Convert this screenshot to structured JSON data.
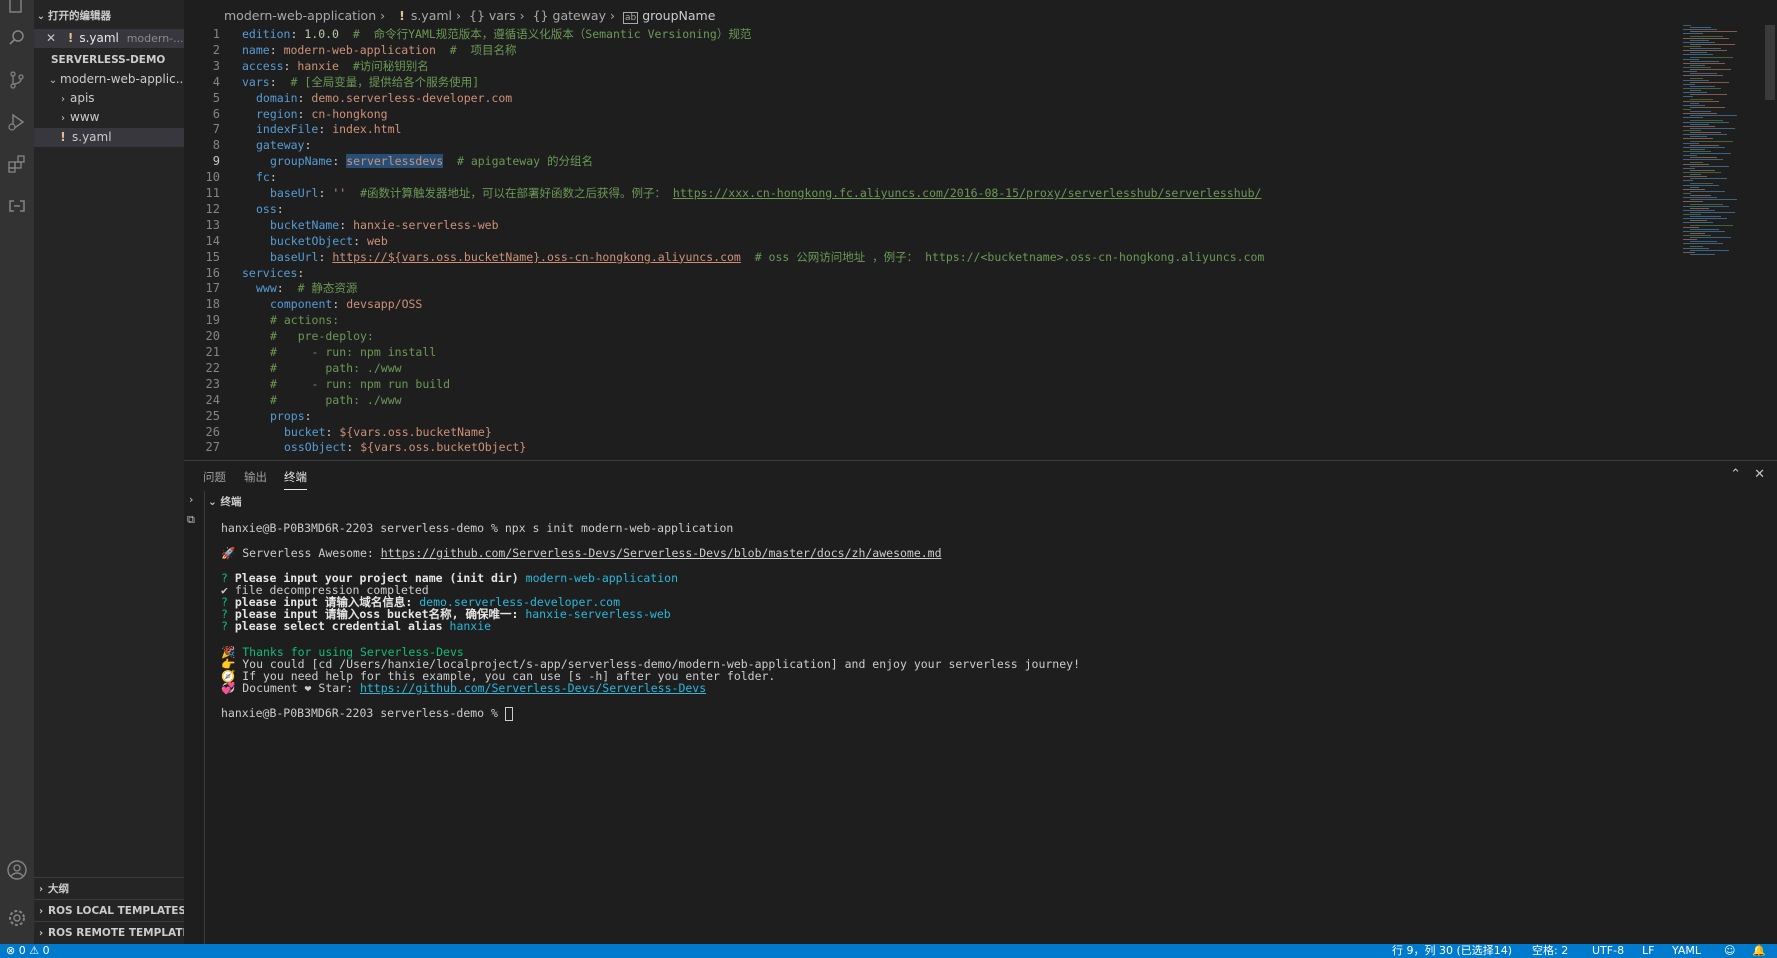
{
  "sidebar": {
    "open_editors_header": "打开的编辑器",
    "open_editor_file": "s.yaml",
    "open_editor_path": "modern-...",
    "workspace_header": "SERVERLESS-DEMO",
    "folder_root": "modern-web-applic...",
    "folder_apis": "apis",
    "folder_www": "www",
    "file_syaml": "s.yaml",
    "outline_header": "大纲",
    "ros_local": "ROS LOCAL TEMPLATES",
    "ros_remote": "ROS REMOTE TEMPLATES"
  },
  "breadcrumb": [
    "modern-web-application",
    "s.yaml",
    "vars",
    "gateway",
    "groupName"
  ],
  "editor": {
    "line_numbers": [
      "1",
      "2",
      "3",
      "4",
      "5",
      "6",
      "7",
      "8",
      "9",
      "10",
      "11",
      "12",
      "13",
      "14",
      "15",
      "16",
      "17",
      "18",
      "19",
      "20",
      "21",
      "22",
      "23",
      "24",
      "25",
      "26",
      "27"
    ],
    "lines": {
      "l1": {
        "k": "edition",
        "v": "1.0.0",
        "c": "#  命令行YAML规范版本，遵循语义化版本（Semantic Versioning）规范"
      },
      "l2": {
        "k": "name",
        "v": "modern-web-application",
        "c": "#  项目名称"
      },
      "l3": {
        "k": "access",
        "v": "hanxie",
        "c": "#访问秘钥别名"
      },
      "l4": {
        "k": "vars",
        "c": "# [全局变量，提供给各个服务使用]"
      },
      "l5": {
        "k": "domain",
        "v": "demo.serverless-developer.com"
      },
      "l6": {
        "k": "region",
        "v": "cn-hongkong"
      },
      "l7": {
        "k": "indexFile",
        "v": "index.html"
      },
      "l8": {
        "k": "gateway"
      },
      "l9": {
        "k": "groupName",
        "v": "serverlessdevs",
        "c": "# apigateway 的分组名"
      },
      "l10": {
        "k": "fc"
      },
      "l11": {
        "k": "baseUrl",
        "v": "''",
        "c": "#函数计算触发器地址，可以在部署好函数之后获得。例子：",
        "link": "https://xxx.cn-hongkong.fc.aliyuncs.com/2016-08-15/proxy/serverlesshub/serverlesshub/"
      },
      "l12": {
        "k": "oss"
      },
      "l13": {
        "k": "bucketName",
        "v": "hanxie-serverless-web"
      },
      "l14": {
        "k": "bucketObject",
        "v": "web"
      },
      "l15": {
        "k": "baseUrl",
        "v": "https://${vars.oss.bucketName}.oss-cn-hongkong.aliyuncs.com",
        "c": "# oss 公网访问地址 ，例子： https://<bucketname>.oss-cn-hongkong.aliyuncs.com"
      },
      "l16": {
        "k": "services"
      },
      "l17": {
        "k": "www",
        "c": "# 静态资源"
      },
      "l18": {
        "k": "component",
        "v": "devsapp/OSS"
      },
      "l19": {
        "c": "# actions:"
      },
      "l20": {
        "c": "#   pre-deploy:"
      },
      "l21": {
        "c": "#     - run: npm install"
      },
      "l22": {
        "c": "#       path: ./www"
      },
      "l23": {
        "c": "#     - run: npm run build"
      },
      "l24": {
        "c": "#       path: ./www"
      },
      "l25": {
        "k": "props"
      },
      "l26": {
        "k": "bucket",
        "v": "${vars.oss.bucketName}"
      },
      "l27": {
        "k": "ossObject",
        "v": "${vars.oss.bucketObject}"
      }
    }
  },
  "panel": {
    "tabs": [
      "问题",
      "输出",
      "终端"
    ],
    "terminal_label": "终端",
    "terminal": {
      "prompt1": "hanxie@B-P0B3MD6R-2203 serverless-demo % npx s init modern-web-application",
      "awesome_prefix": "🚀 Serverless Awesome: ",
      "awesome_link": "https://github.com/Serverless-Devs/Serverless-Devs/blob/master/docs/zh/awesome.md",
      "q1_label": "Please input your project name (init dir)",
      "q1_value": "modern-web-application",
      "decompress": "✔ file decompression completed",
      "q2_label": "please input 请输入域名信息:",
      "q2_value": "demo.serverless-developer.com",
      "q3_label": "please input 请输入oss bucket名称, 确保唯一:",
      "q3_value": "hanxie-serverless-web",
      "q4_label": "please select credential alias",
      "q4_value": "hanxie",
      "thanks": "🎉 Thanks for using Serverless-Devs",
      "could": "👉 You could [cd /Users/hanxie/localproject/s-app/serverless-demo/modern-web-application] and enjoy your serverless journey!",
      "help": "🧭 If you need help for this example, you can use [s -h] after you enter folder.",
      "doc_prefix": "💞 Document ❤ Star: ",
      "doc_link": "https://github.com/Serverless-Devs/Serverless-Devs",
      "prompt2": "hanxie@B-P0B3MD6R-2203 serverless-demo % "
    }
  },
  "status": {
    "errors": "⊗ 0 ⚠ 0",
    "position": "行 9，列 30 (已选择14)",
    "spaces": "空格: 2",
    "encoding": "UTF-8",
    "eol": "LF",
    "language": "YAML"
  },
  "icons": [
    "files-icon",
    "search-icon",
    "source-control-icon",
    "run-debug-icon",
    "extensions-icon",
    "remote-icon",
    "account-icon",
    "settings-icon"
  ],
  "colors": {
    "accent": "#007acc",
    "keyword": "#569cd6",
    "string": "#ce9178",
    "comment": "#6a9955"
  }
}
